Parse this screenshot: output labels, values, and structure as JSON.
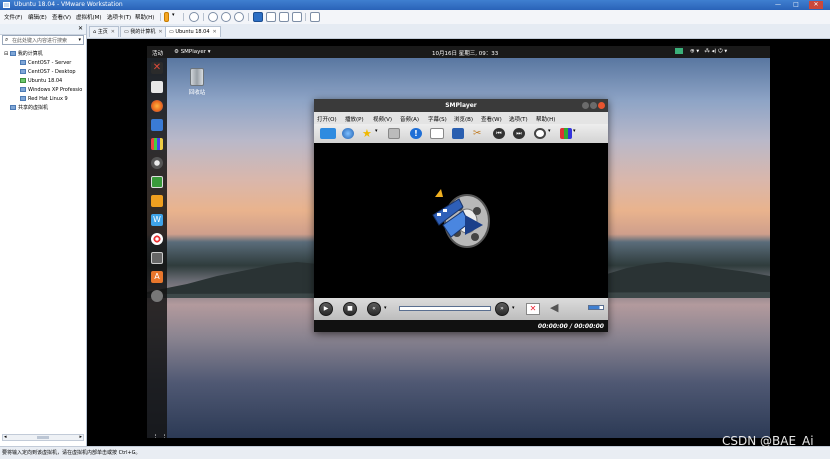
{
  "window": {
    "title": "Ubuntu 18.04 - VMware Workstation",
    "controls": [
      "—",
      "□",
      "✕"
    ]
  },
  "menubar": {
    "items": [
      "文件(F)",
      "编辑(E)",
      "查看(V)",
      "虚拟机(M)",
      "选项卡(T)",
      "帮助(H)"
    ]
  },
  "library": {
    "search_placeholder": "在此处键入内容进行搜索",
    "root_label": "我的计算机",
    "vms": [
      "CentOS7 - Server",
      "CentOS7 - Desktop",
      "Ubuntu 18.04",
      "Windows XP Professio",
      "Red Hat Linux 9"
    ],
    "shared_label": "共享的虚拟机"
  },
  "tabs": {
    "items": [
      "主页",
      "我的计算机",
      "Ubuntu 18.04"
    ]
  },
  "ubuntu": {
    "activities": "活动",
    "app_menu": "SMPlayer ▾",
    "clock": "10月16日 星期三, 09：33",
    "trash_label": "回收站"
  },
  "smplayer": {
    "title": "SMPlayer",
    "menu": [
      "打开(O)",
      "播放(P)",
      "视频(V)",
      "音频(A)",
      "字幕(S)",
      "浏览(B)",
      "查看(W)",
      "选项(T)",
      "帮助(H)"
    ],
    "time": "00:00:00 / 00:00:00"
  },
  "statusbar": {
    "text": "要将输入定向到该虚拟机，请在虚拟机内部单击或按 Ctrl+G。"
  },
  "watermark": "CSDN @BAE_Ai"
}
